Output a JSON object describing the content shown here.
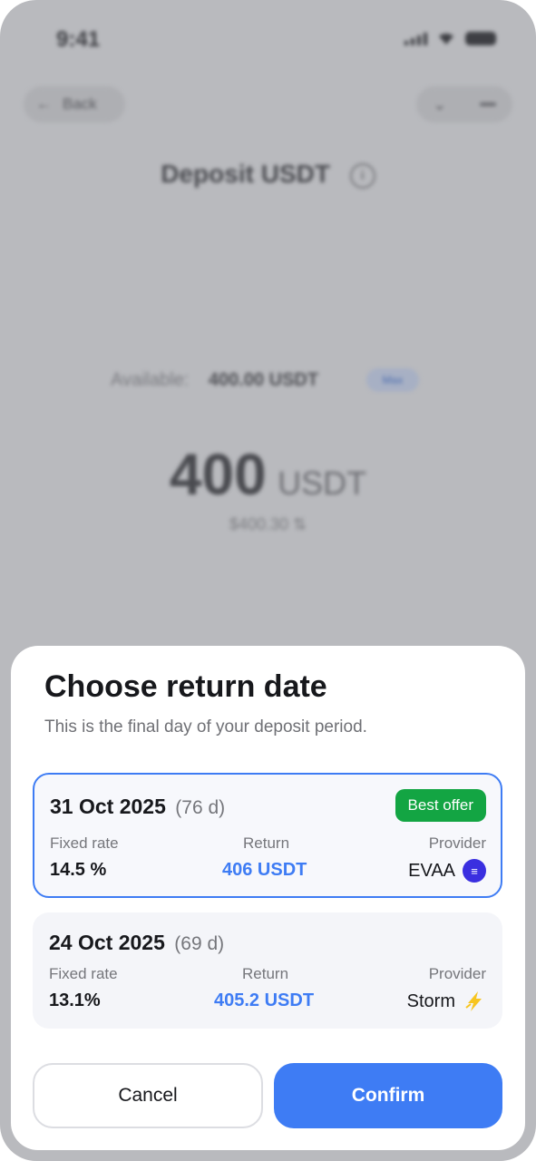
{
  "status_bar": {
    "time": "9:41"
  },
  "background": {
    "back_label": "Back",
    "title": "Deposit USDT",
    "available_label": "Available:",
    "available_value": "400.00 USDT",
    "max_label": "Max",
    "amount": "400",
    "amount_currency": "USDT",
    "usd_equivalent": "$400.30 ⇅"
  },
  "sheet": {
    "title": "Choose return date",
    "subtitle": "This is the final day of your deposit period.",
    "offers": [
      {
        "date": "31 Oct 2025",
        "days": "(76 d)",
        "badge": "Best offer",
        "rate_label": "Fixed rate",
        "rate_value": "14.5 %",
        "return_label": "Return",
        "return_value": "406 USDT",
        "provider_label": "Provider",
        "provider_value": "EVAA",
        "provider_icon": "evaa-icon",
        "selected": true
      },
      {
        "date": "24 Oct 2025",
        "days": "(69 d)",
        "rate_label": "Fixed rate",
        "rate_value": "13.1%",
        "return_label": "Return",
        "return_value": "405.2 USDT",
        "provider_label": "Provider",
        "provider_value": "Storm",
        "provider_icon": "lightning-icon",
        "selected": false
      }
    ],
    "cancel_label": "Cancel",
    "confirm_label": "Confirm"
  },
  "colors": {
    "accent": "#3e7cf4",
    "badge": "#13a543",
    "overlay": "#b9babe"
  }
}
